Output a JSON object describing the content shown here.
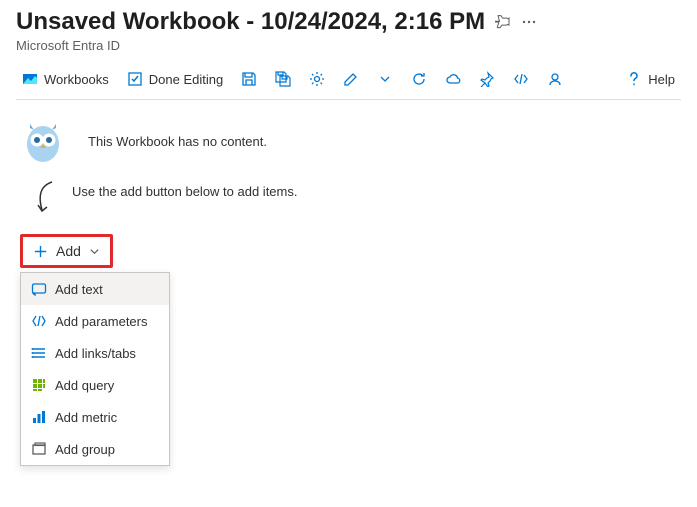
{
  "header": {
    "title": "Unsaved Workbook - 10/24/2024, 2:16 PM",
    "subtitle": "Microsoft Entra ID"
  },
  "toolbar": {
    "workbooks": "Workbooks",
    "done_editing": "Done Editing",
    "help": "Help"
  },
  "body": {
    "empty_msg": "This Workbook has no content.",
    "hint": "Use the add button below to add items.",
    "add_label": "Add"
  },
  "menu": {
    "items": [
      {
        "label": "Add text"
      },
      {
        "label": "Add parameters"
      },
      {
        "label": "Add links/tabs"
      },
      {
        "label": "Add query"
      },
      {
        "label": "Add metric"
      },
      {
        "label": "Add group"
      }
    ]
  }
}
